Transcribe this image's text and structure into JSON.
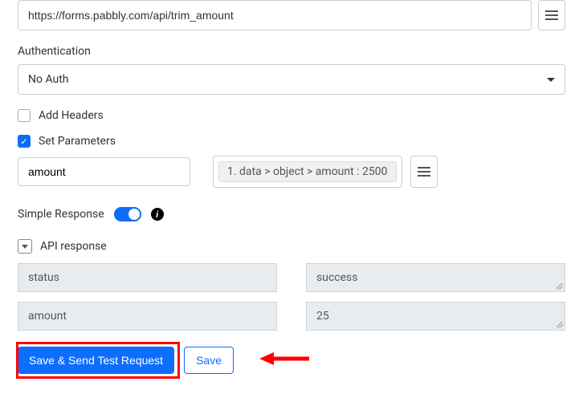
{
  "url": "https://forms.pabbly.com/api/trim_amount",
  "auth": {
    "label": "Authentication",
    "value": "No Auth"
  },
  "headers": {
    "label": "Add Headers",
    "checked": false
  },
  "params": {
    "label": "Set Parameters",
    "checked": true,
    "rows": [
      {
        "key": "amount",
        "valueChip": "1. data > object > amount : 2500"
      }
    ]
  },
  "simpleResponse": {
    "label": "Simple Response",
    "enabled": true
  },
  "apiResponse": {
    "label": "API response",
    "expanded": true,
    "rows": [
      {
        "key": "status",
        "value": "success"
      },
      {
        "key": "amount",
        "value": "25"
      }
    ]
  },
  "buttons": {
    "sendTest": "Save & Send Test Request",
    "save": "Save"
  },
  "colors": {
    "primary": "#0d6efd",
    "highlight": "#ff0000"
  }
}
